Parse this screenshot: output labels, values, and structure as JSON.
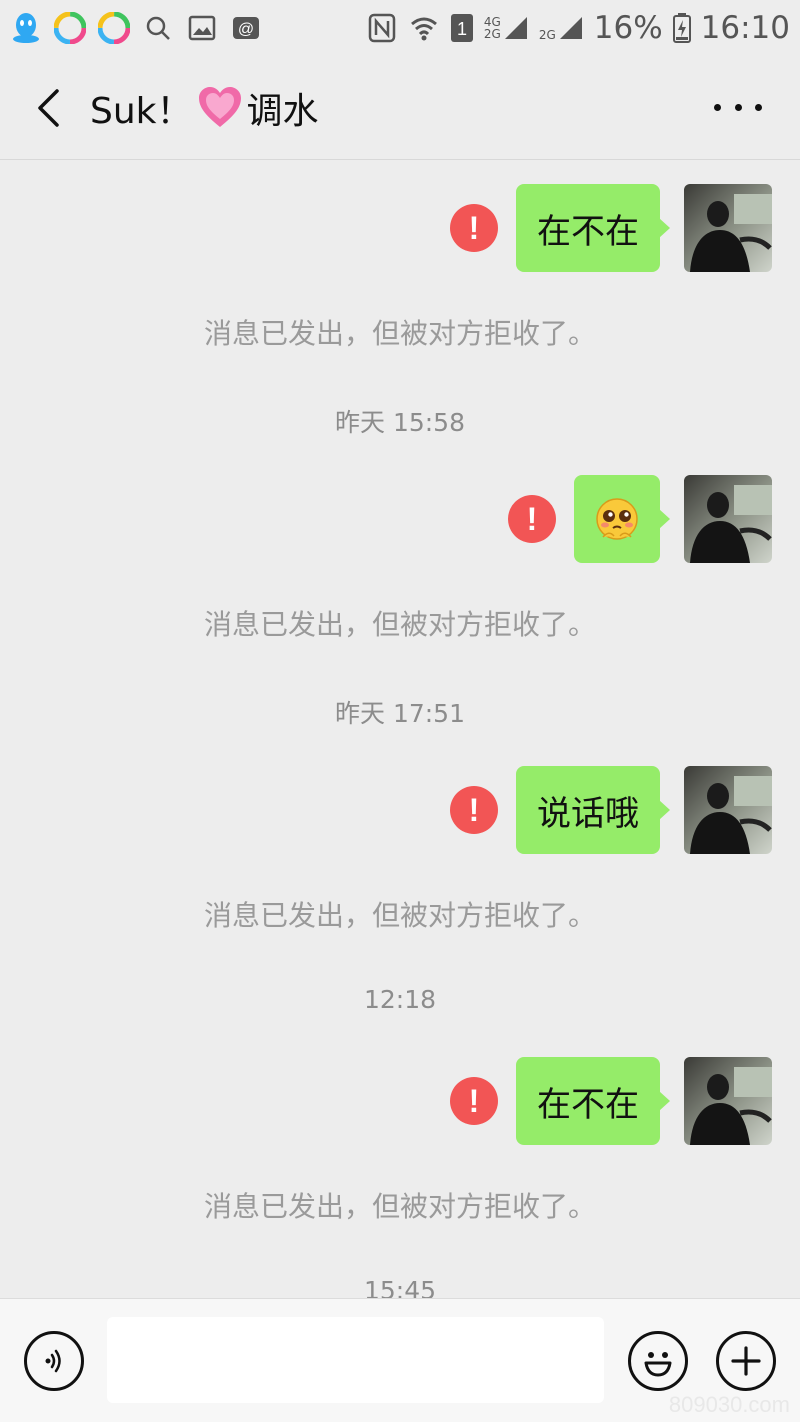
{
  "status_bar": {
    "network_4g": "4G",
    "network_2g": "2G",
    "network_2g_b": "2G",
    "sim_slot": "1",
    "battery": "16%",
    "time": "16:10"
  },
  "header": {
    "title_prefix": "Suk！",
    "title_suffix": "调水"
  },
  "messages": [
    {
      "text": "在不在",
      "notice": "消息已发出，但被对方拒收了。"
    },
    {
      "timestamp": "昨天 15:58"
    },
    {
      "emoji": "shy-face",
      "notice": "消息已发出，但被对方拒收了。"
    },
    {
      "timestamp": "昨天 17:51"
    },
    {
      "text": "说话哦",
      "notice": "消息已发出，但被对方拒收了。"
    },
    {
      "timestamp": "12:18"
    },
    {
      "text": "在不在",
      "notice": "消息已发出，但被对方拒收了。"
    },
    {
      "timestamp": "15:45"
    }
  ],
  "chat": {
    "m1_text": "在不在",
    "m1_notice": "消息已发出，但被对方拒收了。",
    "ts1": "昨天 15:58",
    "m2_notice": "消息已发出，但被对方拒收了。",
    "ts2": "昨天 17:51",
    "m3_text": "说话哦",
    "m3_notice": "消息已发出，但被对方拒收了。",
    "ts3": "12:18",
    "m4_text": "在不在",
    "m4_notice": "消息已发出，但被对方拒收了。",
    "ts4": "15:45"
  },
  "input_bar": {
    "placeholder": ""
  },
  "watermark": "809030.com",
  "colors": {
    "bubble": "#95ec69",
    "error": "#f25555",
    "background": "#ededed"
  }
}
